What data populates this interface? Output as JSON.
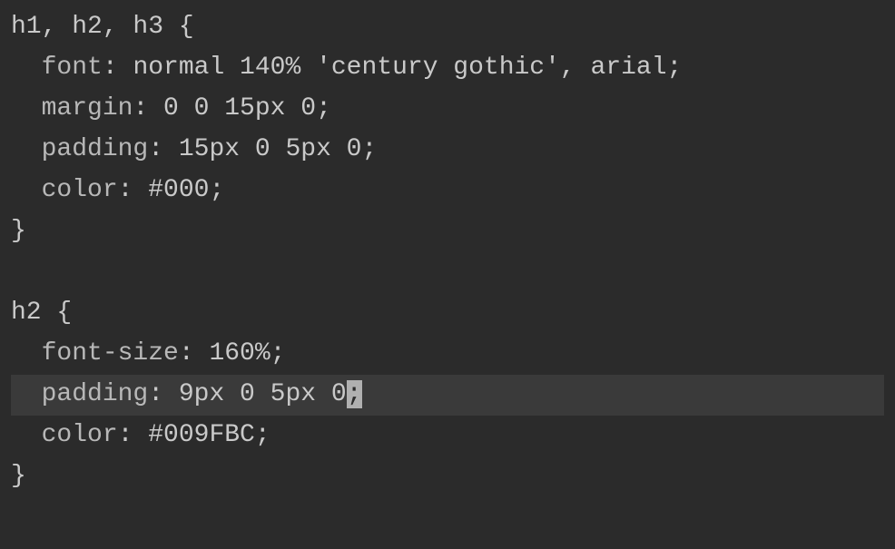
{
  "code": {
    "line1": {
      "selector": "h1, h2, h3",
      "brace": " {"
    },
    "line2": {
      "indent": "  ",
      "property": "font",
      "colon": ": ",
      "value": "normal 140% 'century gothic', arial",
      "semicolon": ";"
    },
    "line3": {
      "indent": "  ",
      "property": "margin",
      "colon": ": ",
      "value": "0 0 15px 0",
      "semicolon": ";"
    },
    "line4": {
      "indent": "  ",
      "property": "padding",
      "colon": ": ",
      "value": "15px 0 5px 0",
      "semicolon": ";"
    },
    "line5": {
      "indent": "  ",
      "property": "color",
      "colon": ": ",
      "value": "#000",
      "semicolon": ";"
    },
    "line6": {
      "brace": "}"
    },
    "line7": {
      "empty": ""
    },
    "line8": {
      "selector": "h2",
      "brace": " {"
    },
    "line9": {
      "indent": "  ",
      "property": "font-size",
      "colon": ": ",
      "value": "160%",
      "semicolon": ";"
    },
    "line10": {
      "indent": "  ",
      "property": "padding",
      "colon": ": ",
      "value": "9px 0 5px 0",
      "semicolon": ";"
    },
    "line11": {
      "indent": "  ",
      "property": "color",
      "colon": ": ",
      "value": "#009FBC",
      "semicolon": ";"
    },
    "line12": {
      "brace": "}"
    }
  }
}
